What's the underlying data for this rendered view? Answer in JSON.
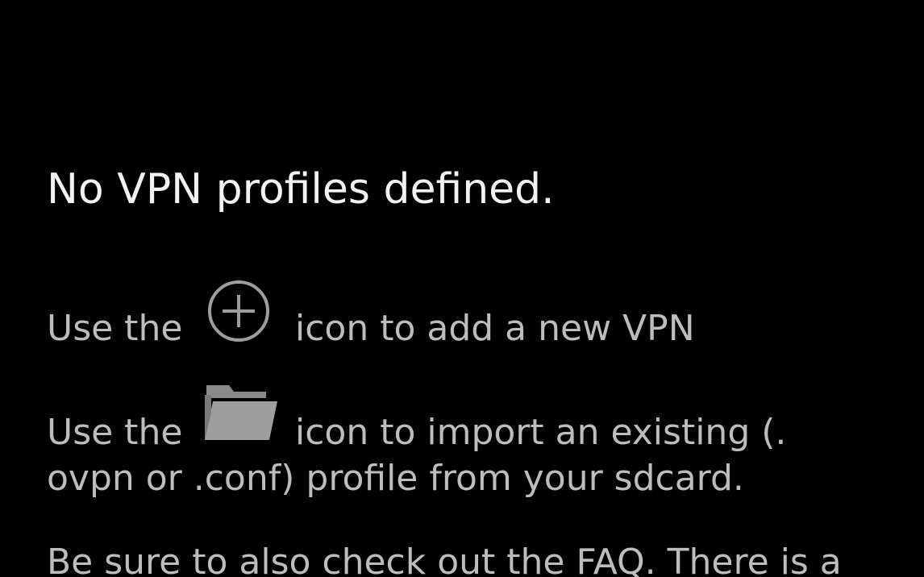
{
  "empty_state": {
    "heading": "No VPN profiles defined.",
    "add_hint": {
      "prefix": "Use the",
      "icon": "add-circle-icon",
      "suffix": "icon to add a new VPN"
    },
    "import_hint": {
      "prefix": "Use the",
      "icon": "folder-icon",
      "suffix": "icon to import an existing (.",
      "continuation": "ovpn or .conf) profile from your sdcard."
    },
    "faq_hint": "Be sure to also check out the FAQ. There is a"
  },
  "colors": {
    "background": "#000000",
    "heading_text": "#f2f2f2",
    "body_text": "#bdbdbd",
    "icon": "#9e9e9e"
  }
}
